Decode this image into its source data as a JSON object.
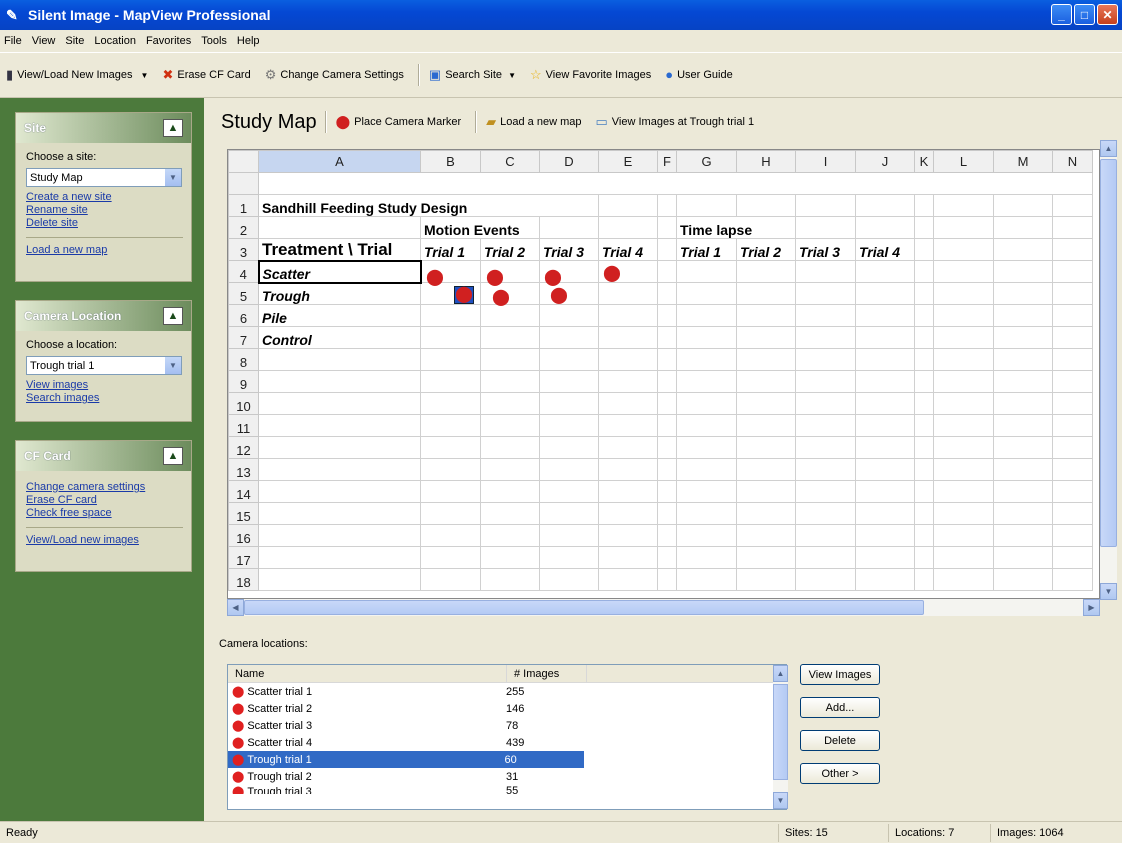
{
  "window": {
    "title": "Silent Image - MapView Professional"
  },
  "menu": [
    "File",
    "View",
    "Site",
    "Location",
    "Favorites",
    "Tools",
    "Help"
  ],
  "toolbar": {
    "view_load": "View/Load New Images",
    "erase": "Erase CF Card",
    "change_camera": "Change Camera Settings",
    "search_site": "Search Site",
    "view_favorites": "View Favorite Images",
    "user_guide": "User Guide"
  },
  "site_panel": {
    "title": "Site",
    "choose_label": "Choose a site:",
    "selected": "Study Map",
    "links": [
      "Create a new site",
      "Rename site",
      "Delete site"
    ],
    "load_map": "Load a new map"
  },
  "camera_panel": {
    "title": "Camera Location",
    "choose_label": "Choose a location:",
    "selected": "Trough trial 1",
    "links": [
      "View images",
      "Search images"
    ]
  },
  "cf_panel": {
    "title": "CF Card",
    "links": [
      "Change camera settings",
      "Erase CF card",
      "Check free space"
    ],
    "view_load": "View/Load new images"
  },
  "map_toolbar": {
    "title": "Study Map",
    "place_marker": "Place Camera Marker",
    "load_map": "Load a new map",
    "view_images": "View Images at Trough trial 1"
  },
  "sheet": {
    "columns": [
      "A",
      "B",
      "C",
      "D",
      "E",
      "F",
      "G",
      "H",
      "I",
      "J",
      "K",
      "L",
      "M",
      "N"
    ],
    "rows": [
      "1",
      "2",
      "3",
      "4",
      "5",
      "6",
      "7",
      "8",
      "9",
      "10",
      "11",
      "12",
      "13",
      "14",
      "15",
      "16",
      "17",
      "18"
    ],
    "title": "Sandhill Feeding Study Design",
    "motion_events": "Motion Events",
    "time_lapse": "Time lapse",
    "treatment_header": "Treatment \\ Trial",
    "trial_labels": [
      "Trial 1",
      "Trial 2",
      "Trial 3",
      "Trial 4"
    ],
    "treatments": [
      "Scatter",
      "Trough",
      "Pile",
      "Control"
    ]
  },
  "camera_locations": {
    "caption": "Camera locations:",
    "col_name": "Name",
    "col_images": "# Images",
    "rows": [
      {
        "name": "Scatter trial 1",
        "count": "255"
      },
      {
        "name": "Scatter trial 2",
        "count": "146"
      },
      {
        "name": "Scatter trial 3",
        "count": "78"
      },
      {
        "name": "Scatter trial 4",
        "count": "439"
      },
      {
        "name": "Trough trial 1",
        "count": "60",
        "selected": true
      },
      {
        "name": "Trough trial 2",
        "count": "31"
      },
      {
        "name": "Trough trial 3",
        "count": "55"
      }
    ],
    "buttons": {
      "view": "View Images",
      "add": "Add...",
      "delete": "Delete",
      "other": "Other >"
    }
  },
  "status": {
    "ready": "Ready",
    "sites": "Sites: 15",
    "locations": "Locations: 7",
    "images": "Images: 1064"
  }
}
